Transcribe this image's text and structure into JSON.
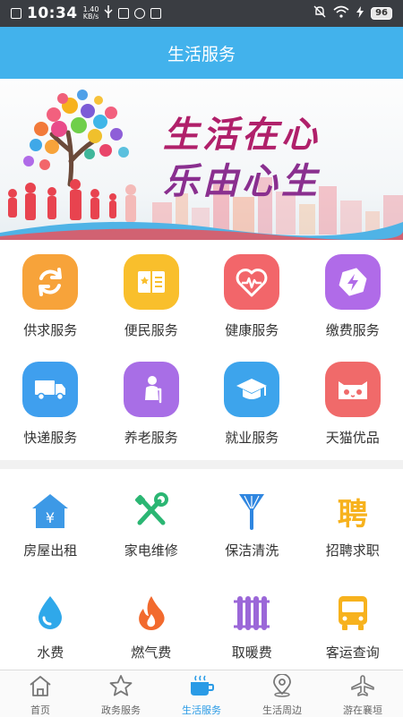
{
  "status_bar": {
    "time": "10:34",
    "speed_value": "1.40",
    "speed_unit": "KB/s",
    "battery": "96"
  },
  "header": {
    "title": "生活服务"
  },
  "banner": {
    "line1": "生活在心",
    "line2": "乐由心生"
  },
  "services_primary": [
    {
      "label": "供求服务",
      "icon": "swap-arrows-icon",
      "color": "#f7a33a"
    },
    {
      "label": "便民服务",
      "icon": "open-book-icon",
      "color": "#f9bf2c"
    },
    {
      "label": "健康服务",
      "icon": "heartbeat-icon",
      "color": "#f2666a"
    },
    {
      "label": "缴费服务",
      "icon": "lightning-bolt-icon",
      "color": "#b06be8"
    },
    {
      "label": "快递服务",
      "icon": "delivery-truck-icon",
      "color": "#3f9fee"
    },
    {
      "label": "养老服务",
      "icon": "elderly-person-icon",
      "color": "#a86ee6"
    },
    {
      "label": "就业服务",
      "icon": "graduation-cap-icon",
      "color": "#3da4ec"
    },
    {
      "label": "天猫优品",
      "icon": "tmall-cat-icon",
      "color": "#f06a6a"
    }
  ],
  "services_secondary": [
    {
      "label": "房屋出租",
      "icon": "house-yuan-icon",
      "color": "#3d99e6"
    },
    {
      "label": "家电维修",
      "icon": "wrench-screwdriver-icon",
      "color": "#2bb673"
    },
    {
      "label": "保洁清洗",
      "icon": "broom-icon",
      "color": "#2f86e0"
    },
    {
      "label": "招聘求职",
      "icon": "recruit-char-icon",
      "color": "#f7b21d"
    },
    {
      "label": "水费",
      "icon": "water-drop-icon",
      "color": "#2fa8ea"
    },
    {
      "label": "燃气费",
      "icon": "flame-icon",
      "color": "#f26a2e"
    },
    {
      "label": "取暖费",
      "icon": "radiator-icon",
      "color": "#9b67d8"
    },
    {
      "label": "客运查询",
      "icon": "bus-icon",
      "color": "#f7b21d"
    }
  ],
  "recruit_char": "聘",
  "yuan_char": "¥",
  "tabbar": [
    {
      "label": "首页",
      "icon": "home-icon",
      "active": false
    },
    {
      "label": "政务服务",
      "icon": "star-icon",
      "active": false
    },
    {
      "label": "生活服务",
      "icon": "coffee-cup-icon",
      "active": true
    },
    {
      "label": "生活周边",
      "icon": "location-pin-icon",
      "active": false
    },
    {
      "label": "游在襄垣",
      "icon": "airplane-icon",
      "active": false
    }
  ]
}
